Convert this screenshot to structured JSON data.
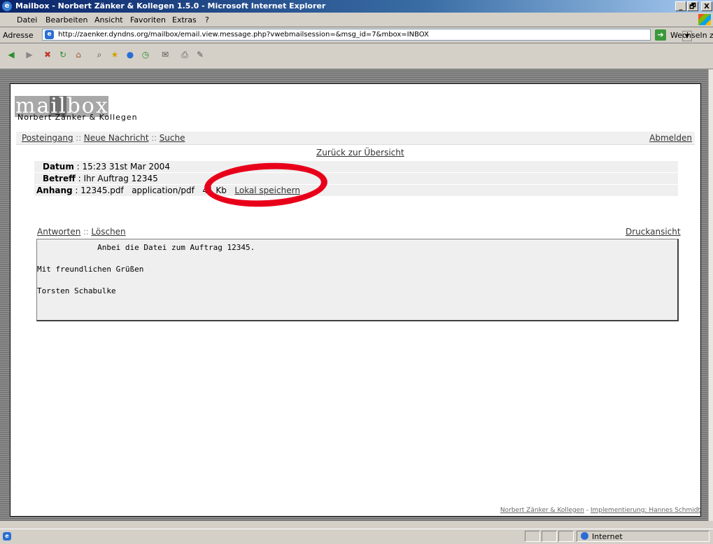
{
  "window": {
    "title": "Mailbox - Norbert Zänker & Kollegen 1.5.0 - Microsoft Internet Explorer",
    "icon": "ie-icon",
    "controls": [
      "_",
      "🗗",
      "X"
    ]
  },
  "menu": {
    "items": [
      "Datei",
      "Bearbeiten",
      "Ansicht",
      "Favoriten",
      "Extras",
      "?"
    ]
  },
  "address": {
    "label": "Adresse",
    "url": "http://zaenker.dyndns.org/mailbox/email.view.message.php?vwebmailsession=&msg_id=7&mbox=INBOX",
    "go_label": "Wechseln zu"
  },
  "toolbar": {
    "icons": [
      "back-icon",
      "forward-icon",
      "stop-icon",
      "refresh-icon",
      "home-icon",
      "search-icon",
      "favorites-icon",
      "media-icon",
      "history-icon",
      "mail-icon",
      "print-icon",
      "edit-icon"
    ]
  },
  "app": {
    "logo_letters": [
      "m",
      "a",
      "i",
      "l",
      "b",
      "o",
      "x"
    ],
    "logo_sub": "Norbert Zänker & Kollegen",
    "nav": {
      "inbox": "Posteingang",
      "new_message": "Neue Nachricht",
      "search": "Suche",
      "separator": "::",
      "logout": "Abmelden"
    },
    "back_link": "Zurück zur Übersicht"
  },
  "message": {
    "date_label": "Datum",
    "date_value": "15:23 31st Mar 2004",
    "subject_label": "Betreff",
    "subject_value": "Ihr Auftrag 12345",
    "attachment_label": "Anhang",
    "attachment_file": "12345.pdf",
    "attachment_type": "application/pdf",
    "attachment_size": "41 Kb",
    "save_local": "Lokal speichern",
    "body": "             Anbei die Datei zum Auftrag 12345.\n\nMit freundlichen Grüßen\n\nTorsten Schabulke"
  },
  "actions": {
    "reply": "Antworten",
    "delete": "Löschen",
    "separator": "::",
    "print_view": "Druckansicht"
  },
  "footer": {
    "company": "Norbert Zänker & Kollegen",
    "dash": " - ",
    "implementation": "Implementierung: Hannes Schmidt"
  },
  "status": {
    "zone": "Internet"
  },
  "colors": {
    "annotation": "#e8001a",
    "titlebar": "#0a246a"
  }
}
